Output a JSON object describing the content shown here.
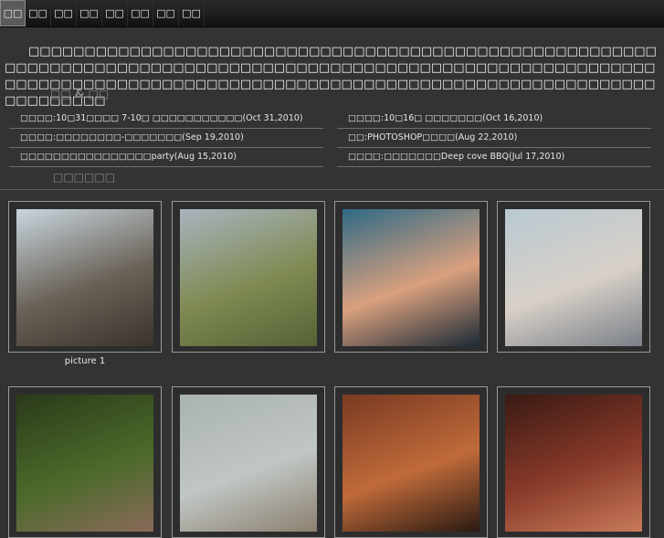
{
  "nav": {
    "items": [
      {
        "label": "□□"
      },
      {
        "label": "□□"
      },
      {
        "label": "□□"
      },
      {
        "label": "□□"
      },
      {
        "label": "□□"
      },
      {
        "label": "□□"
      },
      {
        "label": "□□"
      },
      {
        "label": "□□"
      }
    ]
  },
  "intro": {
    "text": "□□□□□□□□□□□□□□□□□□□□□□□□□□□□□□□□□□□□□□□□□□□□□□□□□□□□□□□□□□□□□□□□□□□□□□□□□□□□□□□□□□□□□□□□□□□□□□□□□□□□□□□□□□□□□□□□□□□□□□□□□□□□□□□□□□□□□□□□□□□□□□□□□□□□□□□□□□□□□□□□□□□□□□□□□□□□□□□□□□□□□"
  },
  "posts_section": {
    "title": "□□ & □□"
  },
  "posts": {
    "left": [
      {
        "text": "□□□□:10□31□□□□ 7-10□ □□□□□□□□□□□(Oct 31,2010)"
      },
      {
        "text": "□□□□:□□□□□□□□-□□□□□□□(Sep 19,2010)"
      },
      {
        "text": "□□□□□□□□□□□□□□□□party(Aug 15,2010)"
      }
    ],
    "right": [
      {
        "text": "□□□□:10□16□ □□□□□□□(Oct 16,2010)"
      },
      {
        "text": "□□:PHOTOSHOP□□□□(Aug 22,2010)"
      },
      {
        "text": "□□□□:□□□□□□□Deep cove BBQ(Jul 17,2010)"
      }
    ]
  },
  "gallery_section": {
    "title": "□□□□□□"
  },
  "gallery": {
    "photos": [
      {
        "caption": "picture 1",
        "colors": [
          "#c9d6df",
          "#6a6258",
          "#3a342c"
        ]
      },
      {
        "caption": "",
        "colors": [
          "#a9b4bf",
          "#7f8a53",
          "#556235"
        ]
      },
      {
        "caption": "",
        "colors": [
          "#2f6a86",
          "#d9a07e",
          "#1c2a36"
        ]
      },
      {
        "caption": "",
        "colors": [
          "#b9c9d2",
          "#d8d0c8",
          "#7a8088"
        ]
      },
      {
        "caption": "",
        "colors": [
          "#2b3a1a",
          "#4a6a2a",
          "#8a6a5a"
        ]
      },
      {
        "caption": "",
        "colors": [
          "#aab3b0",
          "#c0c6c4",
          "#8c8070"
        ]
      },
      {
        "caption": "",
        "colors": [
          "#7a3a22",
          "#c06a3a",
          "#2a1a12"
        ]
      },
      {
        "caption": "",
        "colors": [
          "#3a1a14",
          "#8a3a2a",
          "#c87a5a"
        ]
      }
    ]
  }
}
